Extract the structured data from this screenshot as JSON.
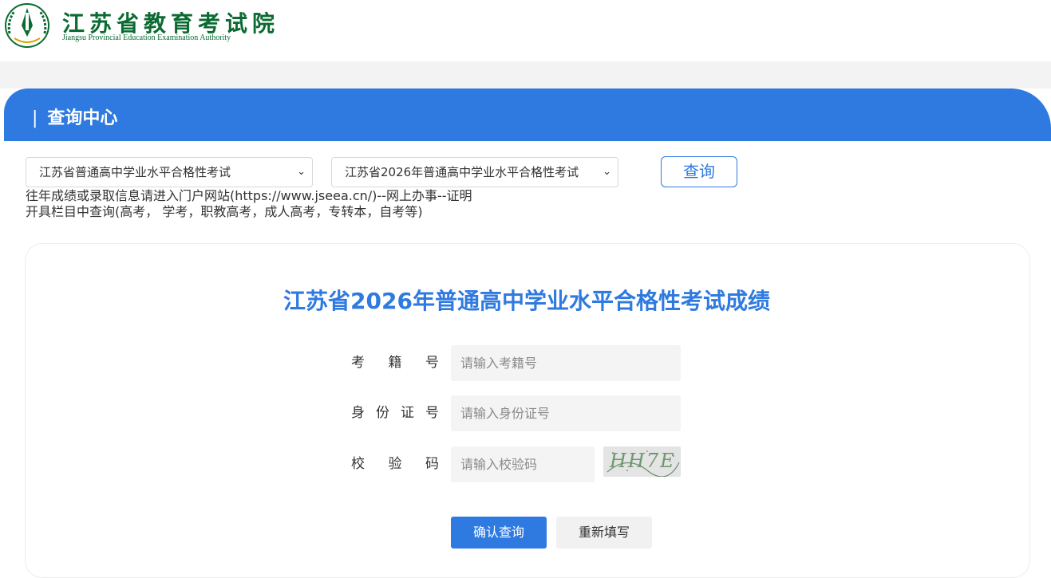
{
  "brand": {
    "title": "江苏省教育考试院",
    "subtitle": "Jiangsu Provincial Education Examination Authority"
  },
  "panel": {
    "bar": "|",
    "title": "查询中心"
  },
  "filters": {
    "exam_type": "江苏省普通高中学业水平合格性考试",
    "exam_session": "江苏省2026年普通高中学业水平合格性考试",
    "query_label": "查询"
  },
  "notice": {
    "line1": "往年成绩或录取信息请进入门户网站(https://www.jseea.cn/)--网上办事--证明",
    "line2": "开具栏目中查询(高考， 学考，职教高考，成人高考，专转本，自考等)"
  },
  "form": {
    "title": "江苏省2026年普通高中学业水平合格性考试成绩",
    "exam_no_label": "考籍号",
    "exam_no_placeholder": "请输入考籍号",
    "id_label": "身份证号",
    "id_placeholder": "请输入身份证号",
    "code_label": "校验码",
    "code_placeholder": "请输入校验码",
    "captcha_text": "HH7E",
    "confirm_label": "确认查询",
    "reset_label": "重新填写"
  },
  "colors": {
    "accent": "#2f7ae0",
    "brand_green": "#0b6b32"
  }
}
